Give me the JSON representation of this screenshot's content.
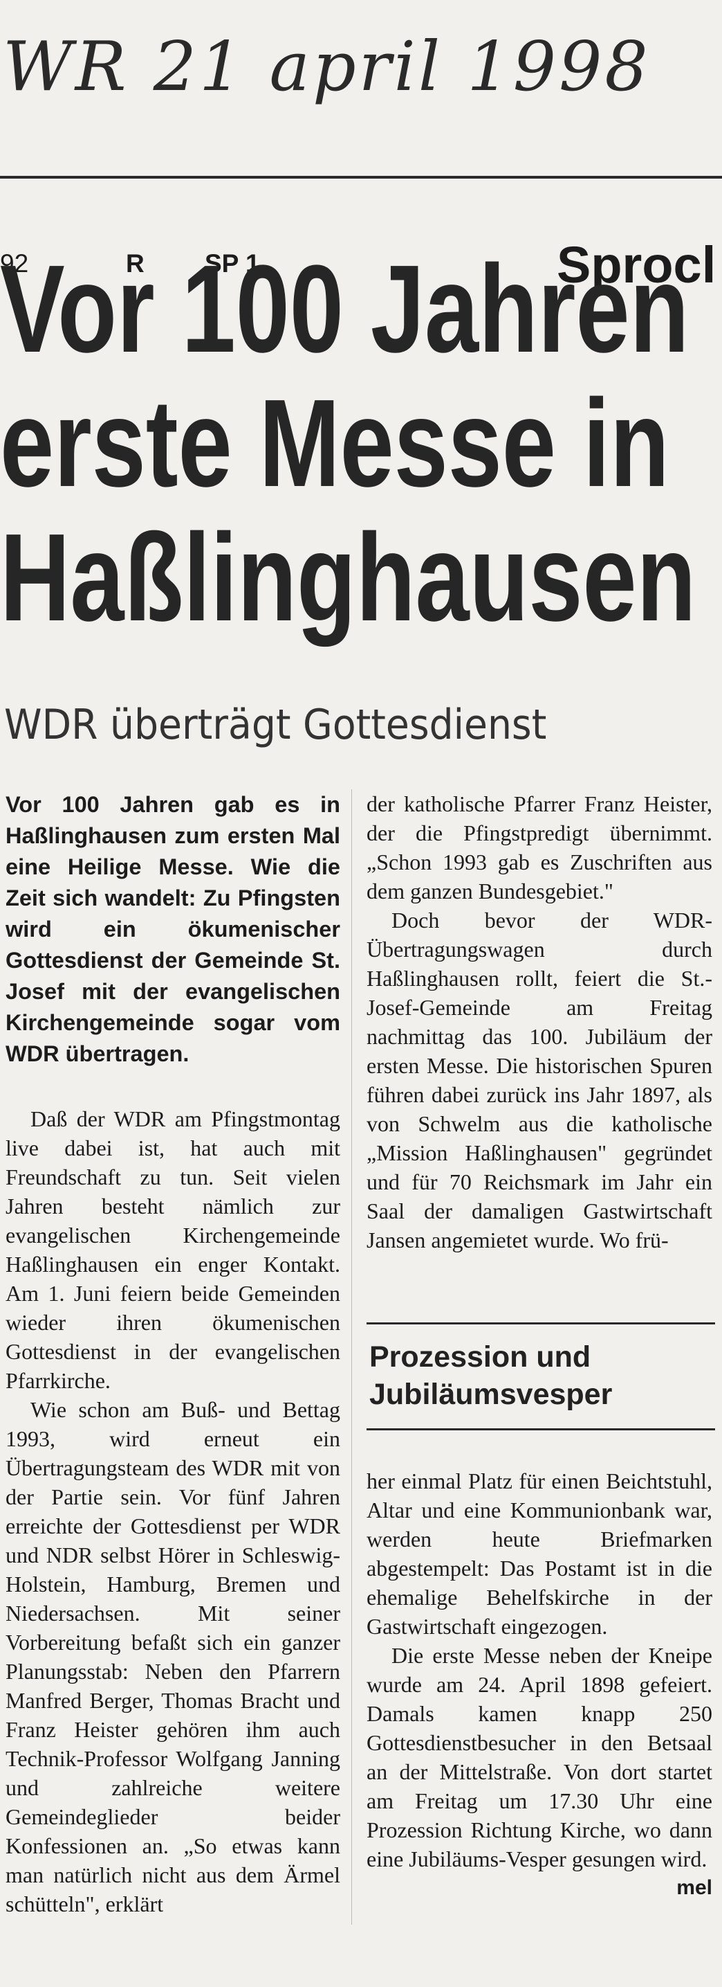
{
  "clipping_note": "WR 21 april 1998",
  "header": {
    "page_number": "92",
    "edition": "R",
    "section_code": "SP 1",
    "section_name": "Sprocl"
  },
  "article": {
    "headline_lines": [
      "Vor 100 Jahren",
      "erste Messe in",
      "Haßlinghausen"
    ],
    "subheadline": "WDR überträgt Gottesdienst",
    "lead": "Vor 100 Jahren gab es in Haßlinghausen zum ersten Mal eine Heilige Messe. Wie die Zeit sich wandelt: Zu Pfingsten wird ein ökumenischer Gottesdienst der Gemeinde St. Josef mit der evangelischen Kirchengemeinde sogar vom WDR übertragen.",
    "left_paragraphs": [
      "Daß der WDR am Pfingstmontag live dabei ist, hat auch mit Freundschaft zu tun. Seit vielen Jahren besteht nämlich zur evangelischen Kirchengemeinde Haßlinghausen ein enger Kontakt. Am 1. Juni feiern beide Gemeinden wieder ihren ökumenischen Gottesdienst in der evangelischen Pfarrkirche.",
      "Wie schon am Buß- und Bettag 1993, wird erneut ein Übertragungsteam des WDR mit von der Partie sein. Vor fünf Jahren erreichte der Gottesdienst per WDR und NDR selbst Hörer in Schleswig-Holstein, Hamburg, Bremen und Niedersachsen. Mit seiner Vorbereitung befaßt sich ein ganzer Planungsstab: Neben den Pfarrern Manfred Berger, Thomas Bracht und Franz Heister gehören ihm auch Technik-Professor Wolfgang Janning und zahlreiche weitere Gemeindeglieder beider Konfessionen an. „So etwas kann man natürlich nicht aus dem Ärmel schütteln\", erklärt"
    ],
    "right_paragraphs": [
      "der katholische Pfarrer Franz Heister, der die Pfingstpredigt übernimmt. „Schon 1993 gab es Zuschriften aus dem ganzen Bundesgebiet.\"",
      "Doch bevor der WDR-Übertragungswagen durch Haßlinghausen rollt, feiert die St.-Josef-Gemeinde am Freitag nachmittag das 100. Jubiläum der ersten Messe. Die historischen Spuren führen dabei zurück ins Jahr 1897, als von Schwelm aus die katholische „Mission Haßlinghausen\" gegründet und für 70 Reichsmark im Jahr ein Saal der damaligen Gastwirtschaft Jansen angemietet wurde. Wo frü-"
    ],
    "subhead_lines": [
      "Prozession und",
      "Jubiläumsvesper"
    ],
    "right_paragraphs_2": [
      "her einmal Platz für einen Beichtstuhl, Altar und eine Kommunionbank war, werden heute Briefmarken abgestempelt: Das Postamt ist in die ehemalige Behelfskirche in der Gastwirtschaft eingezogen.",
      "Die erste Messe neben der Kneipe wurde am 24. April 1898 gefeiert. Damals kamen knapp 250 Gottesdienstbesucher in den Betsaal an der Mittelstraße. Von dort startet am Freitag um 17.30 Uhr eine Prozession Richtung Kirche, wo dann eine Jubiläums-Vesper gesungen wird."
    ],
    "author": "mel"
  }
}
